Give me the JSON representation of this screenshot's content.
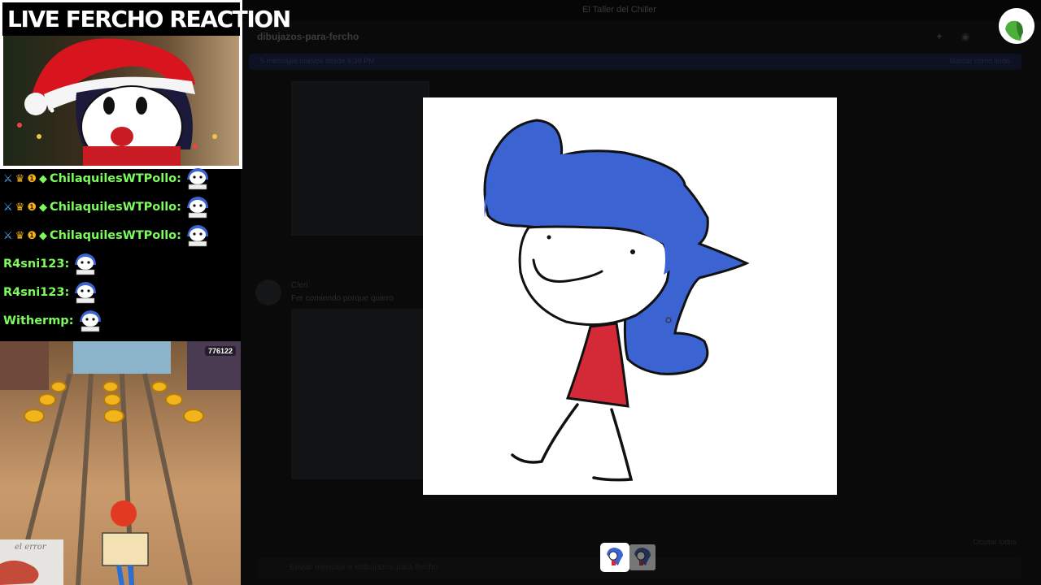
{
  "stream": {
    "title": "LIVE FERCHO REACTION"
  },
  "chat": {
    "messages": [
      {
        "user": "ChilaquilesWTPollo:",
        "color": "#7CFC5A",
        "badges": true
      },
      {
        "user": "ChilaquilesWTPollo:",
        "color": "#7CFC5A",
        "badges": true
      },
      {
        "user": "ChilaquilesWTPollo:",
        "color": "#7CFC5A",
        "badges": true
      },
      {
        "user": "R4sni123:",
        "color": "#7CFC5A",
        "badges": false
      },
      {
        "user": "R4sni123:",
        "color": "#7CFC5A",
        "badges": false
      },
      {
        "user": "Withermp:",
        "color": "#7CFC5A",
        "badges": false
      }
    ]
  },
  "game": {
    "score": "776122",
    "hand_text": "el error"
  },
  "discord": {
    "server": "El Taller del Chiller",
    "channel": "dibujazos-para-fercho",
    "new_messages": "5 mensajes nuevos desde 6:39 PM",
    "mark_read": "Marcar como leído",
    "author": "Cleri",
    "message": "Fer comiendo porque quiero",
    "input_placeholder": "Enviar mensaje a #dibujazos-para-fercho",
    "hide_label": "Ocultar todos"
  },
  "colors": {
    "hair_blue": "#3B63D1",
    "shirt_red": "#D42A38",
    "chat_name": "#7CFC5A",
    "lightbox_bg": "#FFFFFF"
  }
}
